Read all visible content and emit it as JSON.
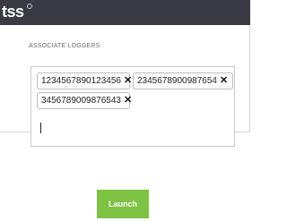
{
  "header": {
    "logo_text": "tss",
    "background_color": "#3a3a44"
  },
  "associate_loggers": {
    "label": "ASSOCIATE LOGGERS",
    "tags": [
      {
        "value": "1234567890123456",
        "remove_glyph": "✕"
      },
      {
        "value": "2345678900987654",
        "remove_glyph": "✕"
      },
      {
        "value": "3456789009876543",
        "remove_glyph": "✕"
      }
    ],
    "input_value": ""
  },
  "actions": {
    "launch_label": "Launch",
    "launch_color": "#7dc242"
  }
}
